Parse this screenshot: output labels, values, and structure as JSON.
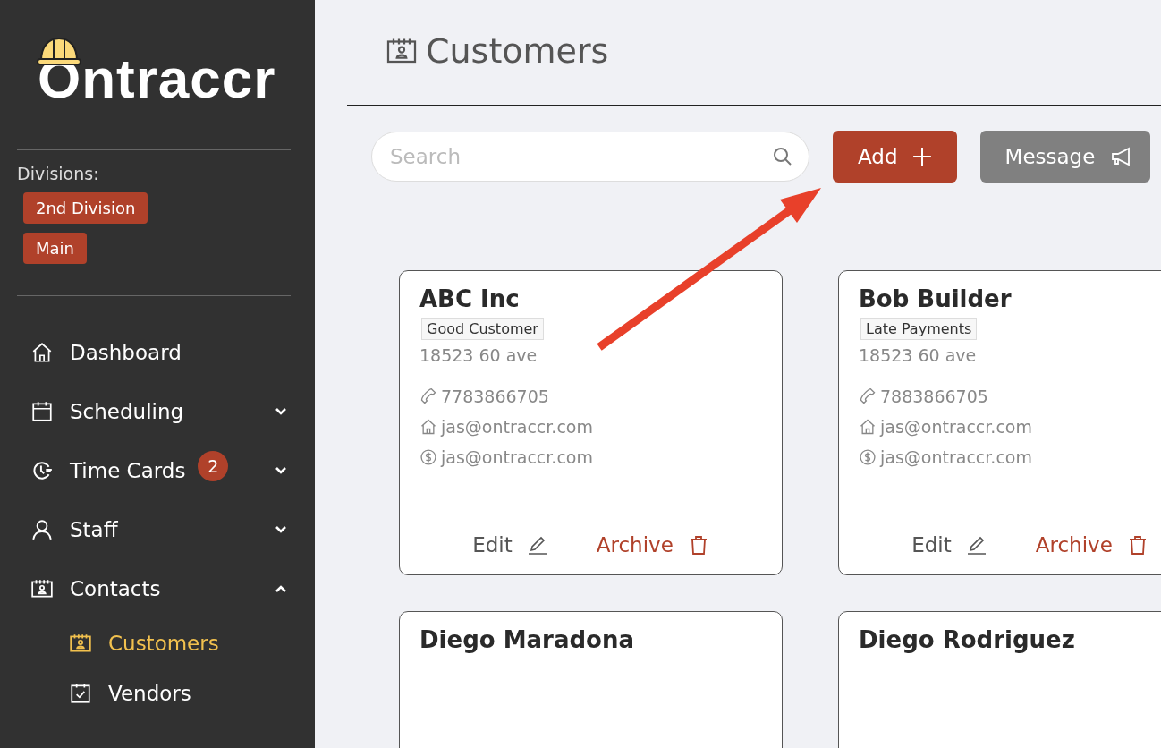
{
  "sidebar": {
    "logo": "Ontraccr",
    "divisions_label": "Divisions:",
    "divisions": [
      "2nd Division",
      "Main"
    ],
    "nav": [
      {
        "label": "Dashboard",
        "selected": false
      },
      {
        "label": "Scheduling",
        "selected": false,
        "expanded": false
      },
      {
        "label": "Time Cards",
        "selected": false,
        "expanded": false,
        "badge": "2"
      },
      {
        "label": "Staff",
        "selected": false,
        "expanded": false
      },
      {
        "label": "Contacts",
        "selected": false,
        "expanded": true,
        "children": [
          {
            "label": "Customers",
            "selected": true
          },
          {
            "label": "Vendors",
            "selected": false
          }
        ]
      }
    ]
  },
  "page": {
    "title": "Customers"
  },
  "toolbar": {
    "search": {
      "placeholder": "Search"
    },
    "add_button": "Add",
    "message_button": "Message"
  },
  "cards": [
    {
      "name": "ABC Inc",
      "tag": "Good Customer",
      "address": "18523 60 ave",
      "phone": "7783866705",
      "email": "jas@ontraccr.com",
      "billing_email": "jas@ontraccr.com",
      "edit": "Edit",
      "archive": "Archive"
    },
    {
      "name": "Bob Builder",
      "tag": "Late Payments",
      "address": "18523 60 ave",
      "phone": "7883866705",
      "email": "jas@ontraccr.com",
      "billing_email": "jas@ontraccr.com",
      "edit": "Edit",
      "archive": "Archive"
    },
    {
      "name": "Diego Maradona"
    },
    {
      "name": "Diego Rodriguez"
    }
  ]
}
